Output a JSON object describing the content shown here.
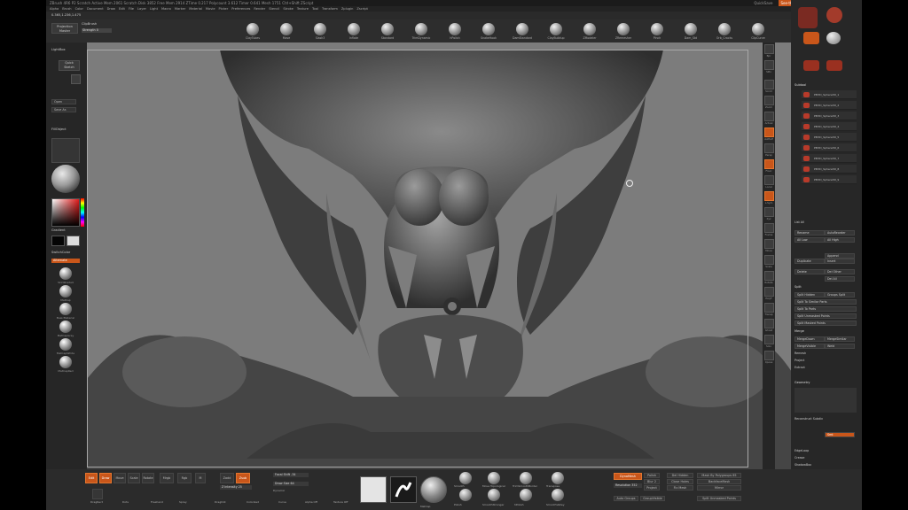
{
  "title_bar": {
    "text": "ZBrush 4R6 P2    Scratch    Active Mem 2061  Scratch Disk 3852  Free Mem 2914  ZTime 0.217  Polycount 3.612  Timer 0.641  Mesh 1751  Ctrl+Shift  ZScript",
    "quicksave": "QuickSave",
    "see_through": "See-through 0",
    "menus_label": "Menus",
    "default_zscript": "DefaultZScript"
  },
  "menu_bar": [
    "Alpha",
    "Brush",
    "Color",
    "Document",
    "Draw",
    "Edit",
    "File",
    "Layer",
    "Light",
    "Macro",
    "Marker",
    "Material",
    "Movie",
    "Picker",
    "Preferences",
    "Render",
    "Stencil",
    "Stroke",
    "Texture",
    "Tool",
    "Transform",
    "Zplugin",
    "Zscript"
  ],
  "coords": "0.365,1.236,1.475",
  "top_shelf": {
    "projection_master": "Projection Master",
    "clip_label": "ClipBrush",
    "strength": "Strength 0",
    "brushes": [
      "ClayTubes",
      "Move",
      "Slash3",
      "Inflate",
      "Standard",
      "TrimDynamic",
      "hPolish",
      "SnakeHook",
      "DamStandard",
      "ClayBuildup",
      "ZModeler",
      "ZRemesher",
      "Pinch",
      "Dam_Std",
      "Orb_Cracks",
      "ClipCurve"
    ]
  },
  "left_panel": {
    "lightbox": "LightBox",
    "quick_sketch": "Quick Sketch",
    "open": "Open",
    "save_as": "Save As",
    "fill_object": "FillObject",
    "gradient": "Gradient",
    "switch_color": "SwitchColor",
    "alternate": "Alternate",
    "materials": [
      "SkinShade4",
      "MatCap",
      "BasicMaterial",
      "MatCapGray",
      "MatCapWhite",
      "MatCapRed"
    ]
  },
  "right_tools": [
    "Bpr",
    "SPix",
    "Scroll",
    "Zoom",
    "Actual",
    "AAHalf",
    "Persp",
    "Floor",
    "Local",
    "L.Sym",
    "Xyz",
    "Frame",
    "Move",
    "Scale",
    "Rotate",
    "PolyF",
    "Transp",
    "Ghost",
    "Solo",
    "Xpose"
  ],
  "right_panel": {
    "subtool_header": "Subtool",
    "subtools": [
      "PM3D_Sphere3D_1",
      "PM3D_Sphere3D_2",
      "PM3D_Sphere3D_3",
      "PM3D_Sphere3D_4",
      "PM3D_Sphere3D_5",
      "PM3D_Sphere3D_6",
      "PM3D_Sphere3D_7",
      "PM3D_Sphere3D_8",
      "PM3D_Sphere3D_9"
    ],
    "list_all": "List All",
    "rename": "Rename",
    "autoreorder": "AutoReorder",
    "all_low": "All Low",
    "all_high": "All High",
    "duplicate": "Duplicate",
    "append": "Append",
    "insert": "Insert",
    "delete": "Delete",
    "del_other": "Del Other",
    "del_all": "Del All",
    "split_header": "Split",
    "split_hidden": "Split Hidden",
    "groups_split": "Groups Split",
    "split_similar": "Split To Similar Parts",
    "split_parts": "Split To Parts",
    "split_unmasked": "Split Unmasked Points",
    "split_masked": "Split Masked Points",
    "merge_header": "Merge",
    "merge_down": "MergeDown",
    "merge_similar": "MergeSimilar",
    "merge_visible": "MergeVisible",
    "weld": "Weld",
    "uv": "Uv",
    "remesh": "Remesh",
    "project": "Project",
    "extract": "Extract",
    "geometry_header": "Geometry",
    "reconstruct": "Reconstruct Subdiv",
    "smooth": "Smt",
    "edgeloop": "EdgeLoop",
    "crease": "Crease",
    "shadowbox": "ShadowBox",
    "claypolish": "ClayPolish",
    "dynamesh": "DynaMesh",
    "zremesher": "ZRemesher",
    "modify_topology": "Modify Topology",
    "position": "Position"
  },
  "bottom_shelf": {
    "edit": "Edit",
    "draw": "Draw",
    "move": "Move",
    "scale": "Scale",
    "rotate": "Rotate",
    "mrgb": "Mrgb",
    "rgb": "Rgb",
    "m": "M",
    "zadd": "Zadd",
    "zsub": "Zsub",
    "rgb_intensity": "Z Intensity 25",
    "focal_shift": "Focal Shift -34",
    "draw_size": "Draw Size 64",
    "dynamic": "Dynamic",
    "stroke_labels": [
      "DragRect",
      "Dots",
      "Freehand",
      "Spray",
      "DragDot",
      "Colorized",
      "Curve"
    ],
    "alpha_labels": [
      "Alpha Off",
      "Texture Off",
      "MatCap"
    ],
    "brush_slots": [
      "Smooth",
      "Move Topological",
      "TrimSmoothBorder",
      "Transpose",
      "Polish",
      "SmoothStronger",
      "hPolish",
      "SmoothValley"
    ],
    "dynamesh": "DynaMesh",
    "resolution": "Resolution 352",
    "polish": "Polish",
    "blur": "Blur 2",
    "groups": "Groups",
    "project": "Project",
    "del_hidden": "Del Hidden",
    "close_holes": "Close Holes",
    "fix_mesh": "Fix Mesh",
    "mirror": "Mirror",
    "mask_by_polygroups": "Mask By Polygroups 85",
    "backfacemask": "BackfaceMask",
    "split_unmasked": "Split Unmasked Points",
    "auto_groups": "Auto Groups",
    "groupvisible": "GroupVisible"
  },
  "colors": {
    "accent": "#c9561a",
    "viewport_bg": "#7c7c7c",
    "panel_bg": "#272727"
  }
}
